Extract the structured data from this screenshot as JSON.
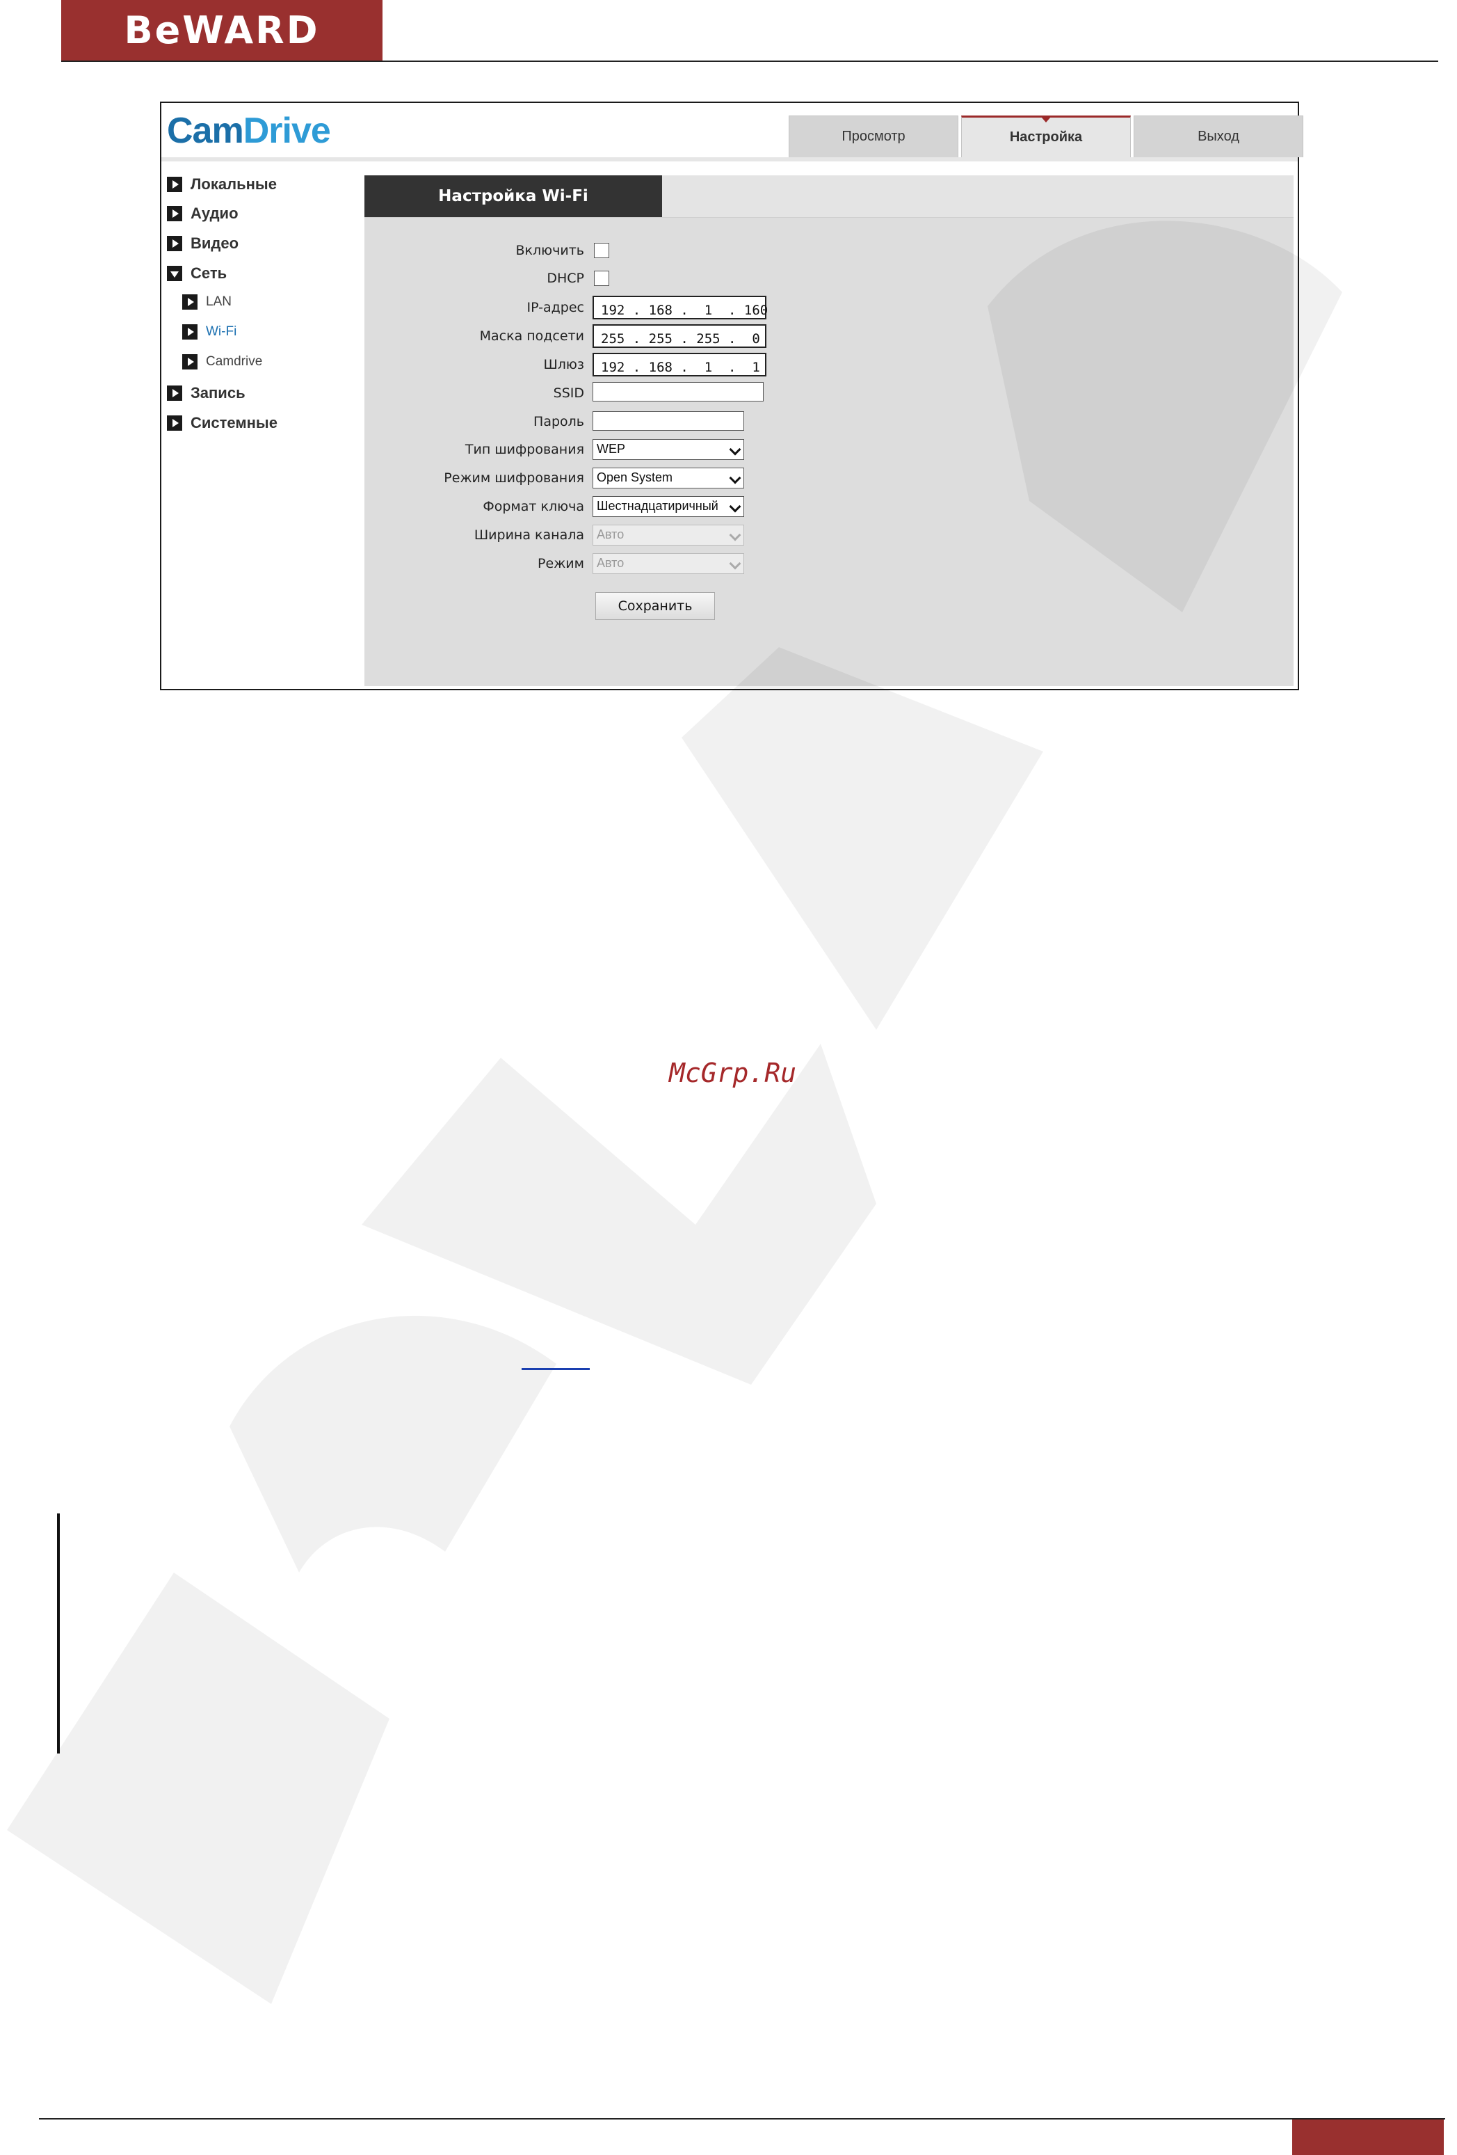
{
  "brand": {
    "logo_text": "BeWARD",
    "accent_color": "#99302f"
  },
  "app": {
    "logo_part1": "Cam",
    "logo_part2": "Drive",
    "tabs": [
      {
        "label": "Просмотр"
      },
      {
        "label": "Настройка",
        "active": true
      },
      {
        "label": "Выход"
      }
    ]
  },
  "sidebar": {
    "items": [
      {
        "label": "Локальные"
      },
      {
        "label": "Аудио"
      },
      {
        "label": "Видео"
      },
      {
        "label": "Сеть",
        "expanded": true
      },
      {
        "label": "LAN"
      },
      {
        "label": "Wi-Fi",
        "active": true
      },
      {
        "label": "Camdrive"
      },
      {
        "label": "Запись"
      },
      {
        "label": "Системные"
      }
    ]
  },
  "panel": {
    "title": "Настройка Wi-Fi",
    "fields": {
      "enable_label": "Включить",
      "enable_checked": false,
      "dhcp_label": "DHCP",
      "dhcp_checked": false,
      "ip_label": "IP-адрес",
      "ip_value": "192 . 168 .  1  . 160",
      "mask_label": "Маска подсети",
      "mask_value": "255 . 255 . 255 .  0",
      "gateway_label": "Шлюз",
      "gateway_value": "192 . 168 .  1  .  1",
      "ssid_label": "SSID",
      "ssid_value": "",
      "password_label": "Пароль",
      "password_value": "",
      "enc_type_label": "Тип шифрования",
      "enc_type_value": "WEP",
      "enc_mode_label": "Режим шифрования",
      "enc_mode_value": "Open System",
      "key_format_label": "Формат ключа",
      "key_format_value": "Шестнадцатиричный",
      "channel_width_label": "Ширина канала",
      "channel_width_value": "Авто",
      "mode_label": "Режим",
      "mode_value": "Авто"
    },
    "save_label": "Сохранить"
  },
  "watermark_text": "McGrp.Ru"
}
